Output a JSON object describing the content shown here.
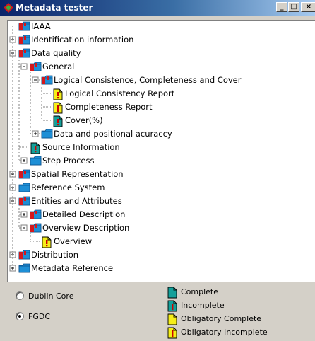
{
  "window": {
    "title": "Metadata tester",
    "min_label": "_",
    "max_label": "□",
    "close_label": "×"
  },
  "tree": [
    {
      "label": "IAAA",
      "icon": "folder-flag-icon",
      "expander": "none",
      "level": 0
    },
    {
      "label": "Identification information",
      "icon": "folder-flag-icon",
      "expander": "plus",
      "level": 0
    },
    {
      "label": "Data quality",
      "icon": "folder-flag-icon",
      "expander": "minus",
      "level": 0
    },
    {
      "label": "General",
      "icon": "folder-flag-icon",
      "expander": "minus",
      "level": 1
    },
    {
      "label": "Logical Consistence, Completeness and Cover",
      "icon": "folder-flag-icon",
      "expander": "minus",
      "level": 2
    },
    {
      "label": "Logical Consistency Report",
      "icon": "obligatory-incomplete-icon",
      "expander": "none",
      "level": 3
    },
    {
      "label": "Completeness Report",
      "icon": "obligatory-incomplete-icon",
      "expander": "none",
      "level": 3
    },
    {
      "label": "Cover(%)",
      "icon": "incomplete-icon",
      "expander": "none",
      "level": 3
    },
    {
      "label": "Data and positional acuraccy",
      "icon": "folder-icon",
      "expander": "plus",
      "level": 2
    },
    {
      "label": "Source Information",
      "icon": "incomplete-icon",
      "expander": "none",
      "level": 1
    },
    {
      "label": "Step Process",
      "icon": "folder-icon",
      "expander": "plus",
      "level": 1
    },
    {
      "label": "Spatial Representation",
      "icon": "folder-flag-icon",
      "expander": "plus",
      "level": 0
    },
    {
      "label": "Reference System",
      "icon": "folder-icon",
      "expander": "plus",
      "level": 0
    },
    {
      "label": "Entities and Attributes",
      "icon": "folder-flag-icon",
      "expander": "minus",
      "level": 0
    },
    {
      "label": "Detailed Description",
      "icon": "folder-flag-icon",
      "expander": "plus",
      "level": 1
    },
    {
      "label": "Overview Description",
      "icon": "folder-flag-icon",
      "expander": "minus",
      "level": 1
    },
    {
      "label": "Overview",
      "icon": "obligatory-incomplete-icon",
      "expander": "none",
      "level": 2
    },
    {
      "label": "Distribution",
      "icon": "folder-flag-icon",
      "expander": "plus",
      "level": 0
    },
    {
      "label": "Metadata Reference",
      "icon": "folder-icon",
      "expander": "plus",
      "level": 0
    }
  ],
  "standards": {
    "options": [
      {
        "label": "Dublin Core",
        "selected": false
      },
      {
        "label": "FGDC",
        "selected": true
      }
    ]
  },
  "legend": [
    {
      "label": "Complete",
      "icon": "complete-icon"
    },
    {
      "label": "Incomplete",
      "icon": "incomplete-icon"
    },
    {
      "label": "Obligatory Complete",
      "icon": "obligatory-complete-icon"
    },
    {
      "label": "Obligatory Incomplete",
      "icon": "obligatory-incomplete-icon"
    }
  ],
  "colors": {
    "folder_blue": "#1e8fd6",
    "flag_red": "#d4181c",
    "complete_teal": "#14a09a",
    "obligatory_yellow": "#f5ee18",
    "warning_red": "#cc0000"
  }
}
